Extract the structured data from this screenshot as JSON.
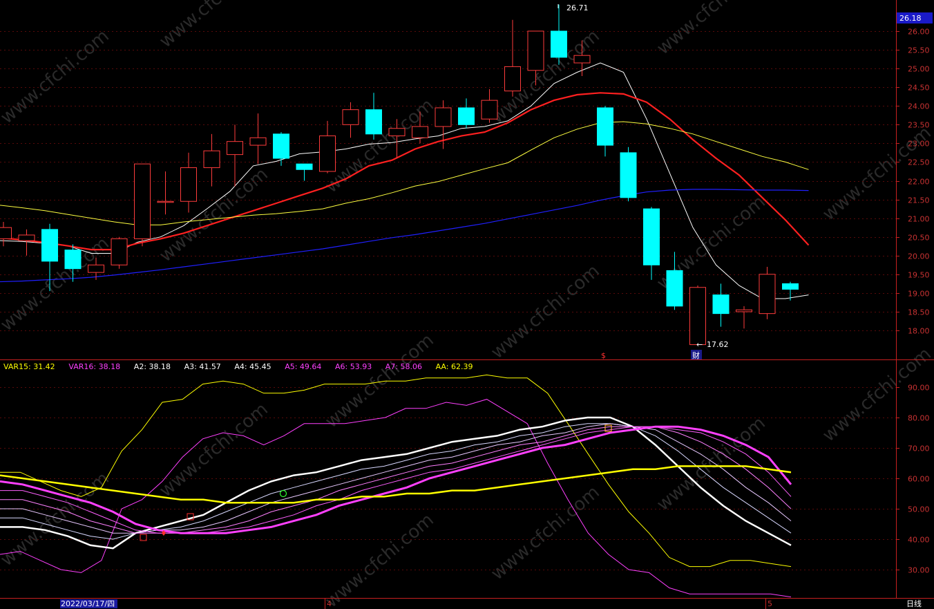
{
  "price_panel": {
    "current_price": "26.18",
    "high_label": "26.71",
    "low_label": "17.62",
    "marker_s": "$",
    "marker_cai": "财"
  },
  "indicator_legend": [
    {
      "name": "VAR15",
      "value": "31.42",
      "color": "#ffff00"
    },
    {
      "name": "VAR16",
      "value": "38.18",
      "color": "#ff40ff"
    },
    {
      "name": "A2",
      "value": "38.18",
      "color": "#ffffff"
    },
    {
      "name": "A3",
      "value": "41.57",
      "color": "#ffffff"
    },
    {
      "name": "A4",
      "value": "45.45",
      "color": "#ffffff"
    },
    {
      "name": "A5",
      "value": "49.64",
      "color": "#ff40ff"
    },
    {
      "name": "A6",
      "value": "53.93",
      "color": "#ff40ff"
    },
    {
      "name": "A7",
      "value": "58.06",
      "color": "#ff40ff"
    },
    {
      "name": "AA",
      "value": "62.39",
      "color": "#ffff00"
    }
  ],
  "bottom_bar": {
    "date_label": "2022/03/17/四",
    "month_4": "4",
    "month_5": "5",
    "period": "日线"
  },
  "watermark": "www.cfchi.com",
  "chart_data": [
    {
      "type": "candlestick",
      "ylim": [
        17.2,
        26.6
      ],
      "yticks": [
        "18.00",
        "18.50",
        "19.00",
        "19.50",
        "20.00",
        "20.50",
        "21.00",
        "21.50",
        "22.00",
        "22.50",
        "23.00",
        "23.50",
        "24.00",
        "24.50",
        "25.00",
        "25.50",
        "26.00"
      ],
      "candles": [
        [
          20.45,
          20.75,
          20.25,
          20.9
        ],
        [
          20.4,
          20.55,
          20.0,
          20.7
        ],
        [
          20.7,
          19.85,
          19.05,
          20.85
        ],
        [
          20.15,
          19.65,
          19.3,
          20.3
        ],
        [
          19.55,
          19.75,
          19.35,
          19.95
        ],
        [
          19.75,
          20.45,
          19.65,
          20.5
        ],
        [
          20.45,
          22.45,
          20.25,
          22.45
        ],
        [
          21.45,
          21.45,
          21.1,
          22.25
        ],
        [
          21.45,
          22.35,
          21.15,
          22.75
        ],
        [
          22.35,
          22.8,
          21.85,
          23.25
        ],
        [
          22.7,
          23.05,
          21.85,
          23.5
        ],
        [
          22.95,
          23.15,
          22.45,
          23.8
        ],
        [
          23.25,
          22.6,
          22.4,
          23.3
        ],
        [
          22.45,
          22.3,
          22.0,
          22.45
        ],
        [
          22.25,
          23.2,
          22.2,
          23.6
        ],
        [
          23.5,
          23.9,
          23.15,
          24.1
        ],
        [
          23.9,
          23.25,
          23.1,
          24.35
        ],
        [
          23.2,
          23.4,
          22.6,
          23.65
        ],
        [
          23.15,
          23.45,
          23.0,
          23.85
        ],
        [
          23.45,
          23.95,
          22.85,
          24.15
        ],
        [
          23.95,
          23.5,
          23.4,
          24.2
        ],
        [
          23.65,
          24.15,
          23.55,
          24.45
        ],
        [
          24.4,
          25.05,
          24.25,
          26.3
        ],
        [
          24.95,
          26.0,
          24.55,
          26.0
        ],
        [
          26.0,
          25.3,
          25.1,
          26.71
        ],
        [
          25.15,
          25.35,
          24.8,
          25.75
        ],
        [
          23.95,
          22.95,
          22.65,
          24.0
        ],
        [
          22.75,
          21.55,
          21.45,
          22.9
        ],
        [
          21.25,
          19.75,
          19.35,
          21.3
        ],
        [
          19.6,
          18.65,
          18.55,
          20.1
        ],
        [
          17.62,
          19.15,
          17.62,
          19.2
        ],
        [
          18.95,
          18.45,
          18.1,
          19.25
        ],
        [
          18.5,
          18.55,
          18.05,
          18.65
        ],
        [
          18.45,
          19.5,
          18.3,
          19.7
        ],
        [
          19.25,
          19.1,
          18.8,
          19.3
        ]
      ],
      "ma_series": [
        {
          "color": "#ffffff",
          "values": [
            20.4,
            20.38,
            20.33,
            20.26,
            20.06,
            20.06,
            20.36,
            20.5,
            20.8,
            21.25,
            21.72,
            22.4,
            22.52,
            22.72,
            22.77,
            22.85,
            22.98,
            23.02,
            23.12,
            23.2,
            23.4,
            23.45,
            23.6,
            24.0,
            24.6,
            24.9,
            25.15,
            24.9,
            23.65,
            22.2,
            20.75,
            19.75,
            19.2,
            18.85,
            18.85,
            18.95
          ]
        },
        {
          "color": "#ff2020",
          "values": [
            20.48,
            20.42,
            20.35,
            20.26,
            20.16,
            20.16,
            20.33,
            20.45,
            20.6,
            20.8,
            21.0,
            21.2,
            21.4,
            21.6,
            21.8,
            22.05,
            22.4,
            22.55,
            22.85,
            23.05,
            23.2,
            23.3,
            23.55,
            23.9,
            24.15,
            24.3,
            24.35,
            24.32,
            24.1,
            23.65,
            23.1,
            22.6,
            22.15,
            21.55,
            20.95,
            20.28
          ]
        },
        {
          "color": "#ffff40",
          "values": [
            21.35,
            21.28,
            21.2,
            21.1,
            21.0,
            20.9,
            20.82,
            20.82,
            20.9,
            20.96,
            21.02,
            21.08,
            21.12,
            21.18,
            21.25,
            21.4,
            21.52,
            21.68,
            21.86,
            21.98,
            22.15,
            22.32,
            22.48,
            22.82,
            23.15,
            23.38,
            23.55,
            23.58,
            23.52,
            23.4,
            23.25,
            23.05,
            22.85,
            22.65,
            22.5,
            22.3
          ]
        },
        {
          "color": "#2020ff",
          "values": [
            19.3,
            19.32,
            19.35,
            19.38,
            19.42,
            19.48,
            19.55,
            19.62,
            19.7,
            19.78,
            19.86,
            19.94,
            20.02,
            20.1,
            20.18,
            20.28,
            20.38,
            20.48,
            20.56,
            20.66,
            20.76,
            20.86,
            20.98,
            21.1,
            21.22,
            21.34,
            21.48,
            21.6,
            21.7,
            21.75,
            21.77,
            21.77,
            21.76,
            21.75,
            21.75,
            21.74
          ]
        }
      ]
    },
    {
      "type": "line",
      "ylim": [
        20,
        98
      ],
      "yticks": [
        "30.00",
        "40.00",
        "50.00",
        "60.00",
        "70.00",
        "80.00",
        "90.00"
      ],
      "series": [
        {
          "name": "VAR15",
          "color": "#ffff00",
          "width": 1,
          "values": [
            62,
            62,
            59,
            56,
            54,
            57,
            69,
            76,
            85,
            86,
            91,
            92,
            91,
            88,
            88,
            89,
            91,
            91,
            91,
            92,
            92,
            93,
            93,
            93,
            94,
            93,
            93,
            88,
            78,
            68,
            58,
            49,
            42,
            34,
            31,
            31,
            33,
            33,
            32,
            31
          ]
        },
        {
          "name": "VAR16",
          "color": "#ff40ff",
          "width": 1,
          "values": [
            35,
            36,
            33,
            30,
            29,
            33,
            50,
            53,
            59,
            67,
            73,
            75,
            74,
            71,
            74,
            78,
            78,
            78,
            79,
            80,
            83,
            83,
            85,
            84,
            86,
            82,
            78,
            65,
            53,
            42,
            35,
            30,
            29,
            24,
            22,
            22,
            22,
            22,
            22,
            21
          ]
        },
        {
          "name": "A2",
          "color": "#ffffff",
          "width": 2.5,
          "values": [
            44,
            44,
            43,
            41,
            38,
            37,
            42,
            44,
            46,
            48,
            52,
            56,
            59,
            61,
            62,
            64,
            66,
            67,
            68,
            70,
            72,
            73,
            74,
            76,
            77,
            79,
            80,
            80,
            77,
            71,
            64,
            57,
            51,
            46,
            42,
            38
          ]
        },
        {
          "name": "A3",
          "color": "#d8d8ff",
          "width": 1,
          "values": [
            47,
            47,
            45,
            43,
            41,
            40,
            42,
            43,
            44,
            46,
            49,
            52,
            55,
            57,
            59,
            61,
            63,
            64,
            66,
            68,
            69,
            71,
            72,
            74,
            75,
            77,
            78,
            78,
            77,
            74,
            69,
            63,
            57,
            52,
            47,
            42
          ]
        },
        {
          "name": "A4",
          "color": "#e8c8ff",
          "width": 1,
          "values": [
            50,
            50,
            48,
            46,
            44,
            42,
            42,
            43,
            43,
            44,
            46,
            49,
            52,
            54,
            56,
            58,
            60,
            62,
            64,
            66,
            67,
            69,
            71,
            72,
            74,
            75,
            77,
            78,
            77,
            76,
            72,
            68,
            63,
            57,
            52,
            46
          ]
        },
        {
          "name": "A5",
          "color": "#ff80ff",
          "width": 1,
          "values": [
            53,
            53,
            51,
            49,
            46,
            44,
            42,
            42,
            42,
            43,
            44,
            46,
            49,
            51,
            53,
            56,
            58,
            60,
            62,
            64,
            65,
            67,
            69,
            71,
            72,
            74,
            76,
            77,
            77,
            77,
            75,
            72,
            68,
            63,
            57,
            50
          ]
        },
        {
          "name": "A6",
          "color": "#ff60ff",
          "width": 1,
          "values": [
            56,
            56,
            54,
            52,
            49,
            46,
            43,
            42,
            42,
            42,
            43,
            44,
            46,
            48,
            51,
            53,
            56,
            58,
            60,
            62,
            63,
            65,
            67,
            69,
            71,
            73,
            75,
            76,
            77,
            77,
            76,
            75,
            72,
            68,
            62,
            54
          ]
        },
        {
          "name": "A7",
          "color": "#ff40ff",
          "width": 3,
          "values": [
            59,
            58,
            56,
            54,
            52,
            49,
            45,
            43,
            42,
            42,
            42,
            43,
            44,
            46,
            48,
            51,
            53,
            55,
            57,
            60,
            62,
            64,
            66,
            68,
            70,
            71,
            73,
            75,
            76,
            77,
            77,
            76,
            74,
            71,
            67,
            58
          ]
        },
        {
          "name": "AA",
          "color": "#ffff00",
          "width": 2.5,
          "values": [
            61,
            60,
            59,
            58,
            57,
            56,
            55,
            54,
            53,
            53,
            52,
            52,
            52,
            52,
            53,
            53,
            54,
            54,
            55,
            55,
            56,
            56,
            57,
            58,
            59,
            60,
            61,
            62,
            63,
            63,
            64,
            64,
            64,
            64,
            63,
            62
          ]
        }
      ]
    }
  ]
}
